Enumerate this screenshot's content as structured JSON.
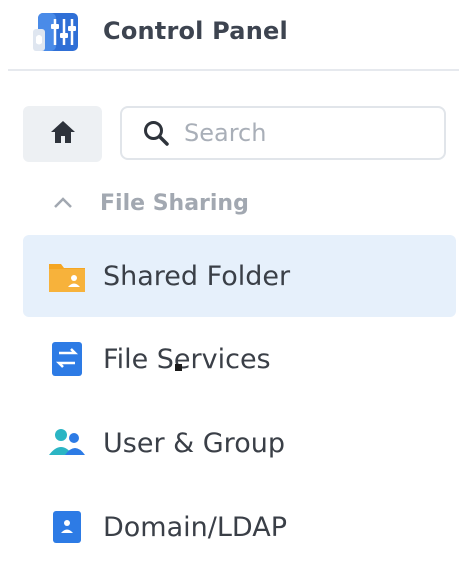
{
  "header": {
    "title": "Control Panel",
    "icon": "control-panel-sliders-icon"
  },
  "toolbar": {
    "home_icon": "home-icon",
    "search": {
      "placeholder": "Search",
      "value": "",
      "icon": "search-icon"
    }
  },
  "section": {
    "label": "File Sharing",
    "icon": "chevron-up-icon",
    "expanded": true
  },
  "nav": {
    "items": [
      {
        "label": "Shared Folder",
        "icon": "shared-folder-icon",
        "selected": true
      },
      {
        "label": "File Services",
        "icon": "file-services-icon",
        "selected": false
      },
      {
        "label": "User & Group",
        "icon": "user-group-icon",
        "selected": false
      },
      {
        "label": "Domain/LDAP",
        "icon": "domain-ldap-icon",
        "selected": false
      }
    ]
  },
  "colors": {
    "selected_bg": "#e6f0fb",
    "accent_blue": "#2d7be5",
    "folder_orange": "#f5a623",
    "users_teal": "#2bb5c4",
    "text": "#3a3f47",
    "muted_text": "#a2a8b1"
  }
}
